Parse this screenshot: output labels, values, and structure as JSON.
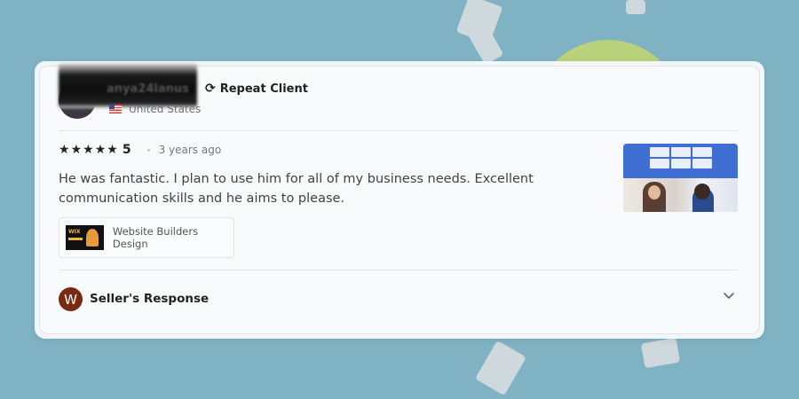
{
  "reviewer": {
    "name": "anya24lanus",
    "country": "United States",
    "badge": "Repeat Client"
  },
  "review": {
    "stars": 5,
    "rating": "5",
    "time": "3 years ago",
    "text": "He was fantastic. I plan to use him for all of my business needs. Excellent communication skills and he aims to please.",
    "gig": {
      "thumb_text": "WIX",
      "label": "Website Builders Design"
    }
  },
  "seller_response": {
    "avatar_letter": "W",
    "label": "Seller's Response"
  },
  "colors": {
    "background": "#7fb3c4",
    "seller_avatar": "#7a2a12",
    "thumbnail_blue": "#3f6fd2"
  },
  "icons": {
    "repeat": "repeat-icon",
    "star": "star-icon",
    "chevron": "chevron-down-icon",
    "flag": "us-flag-icon"
  }
}
